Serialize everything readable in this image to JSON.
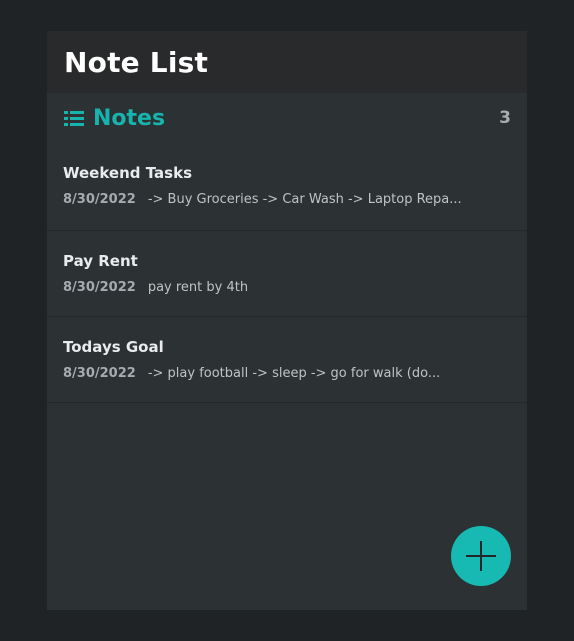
{
  "header": {
    "title": "Note List"
  },
  "notes_bar": {
    "icon": "list-icon",
    "label": "Notes",
    "count": "3"
  },
  "notes": [
    {
      "title": "Weekend Tasks",
      "date": "8/30/2022",
      "preview": "-> Buy Groceries -> Car Wash -> Laptop Repa..."
    },
    {
      "title": "Pay Rent",
      "date": "8/30/2022",
      "preview": "pay rent by 4th"
    },
    {
      "title": "Todays Goal",
      "date": "8/30/2022",
      "preview": "-> play football -> sleep -> go for walk (do..."
    }
  ],
  "fab": {
    "icon": "plus-icon"
  },
  "colors": {
    "background": "#202325",
    "panel": "#2c3134",
    "header": "#292a2b",
    "accent": "#17b3ad"
  }
}
